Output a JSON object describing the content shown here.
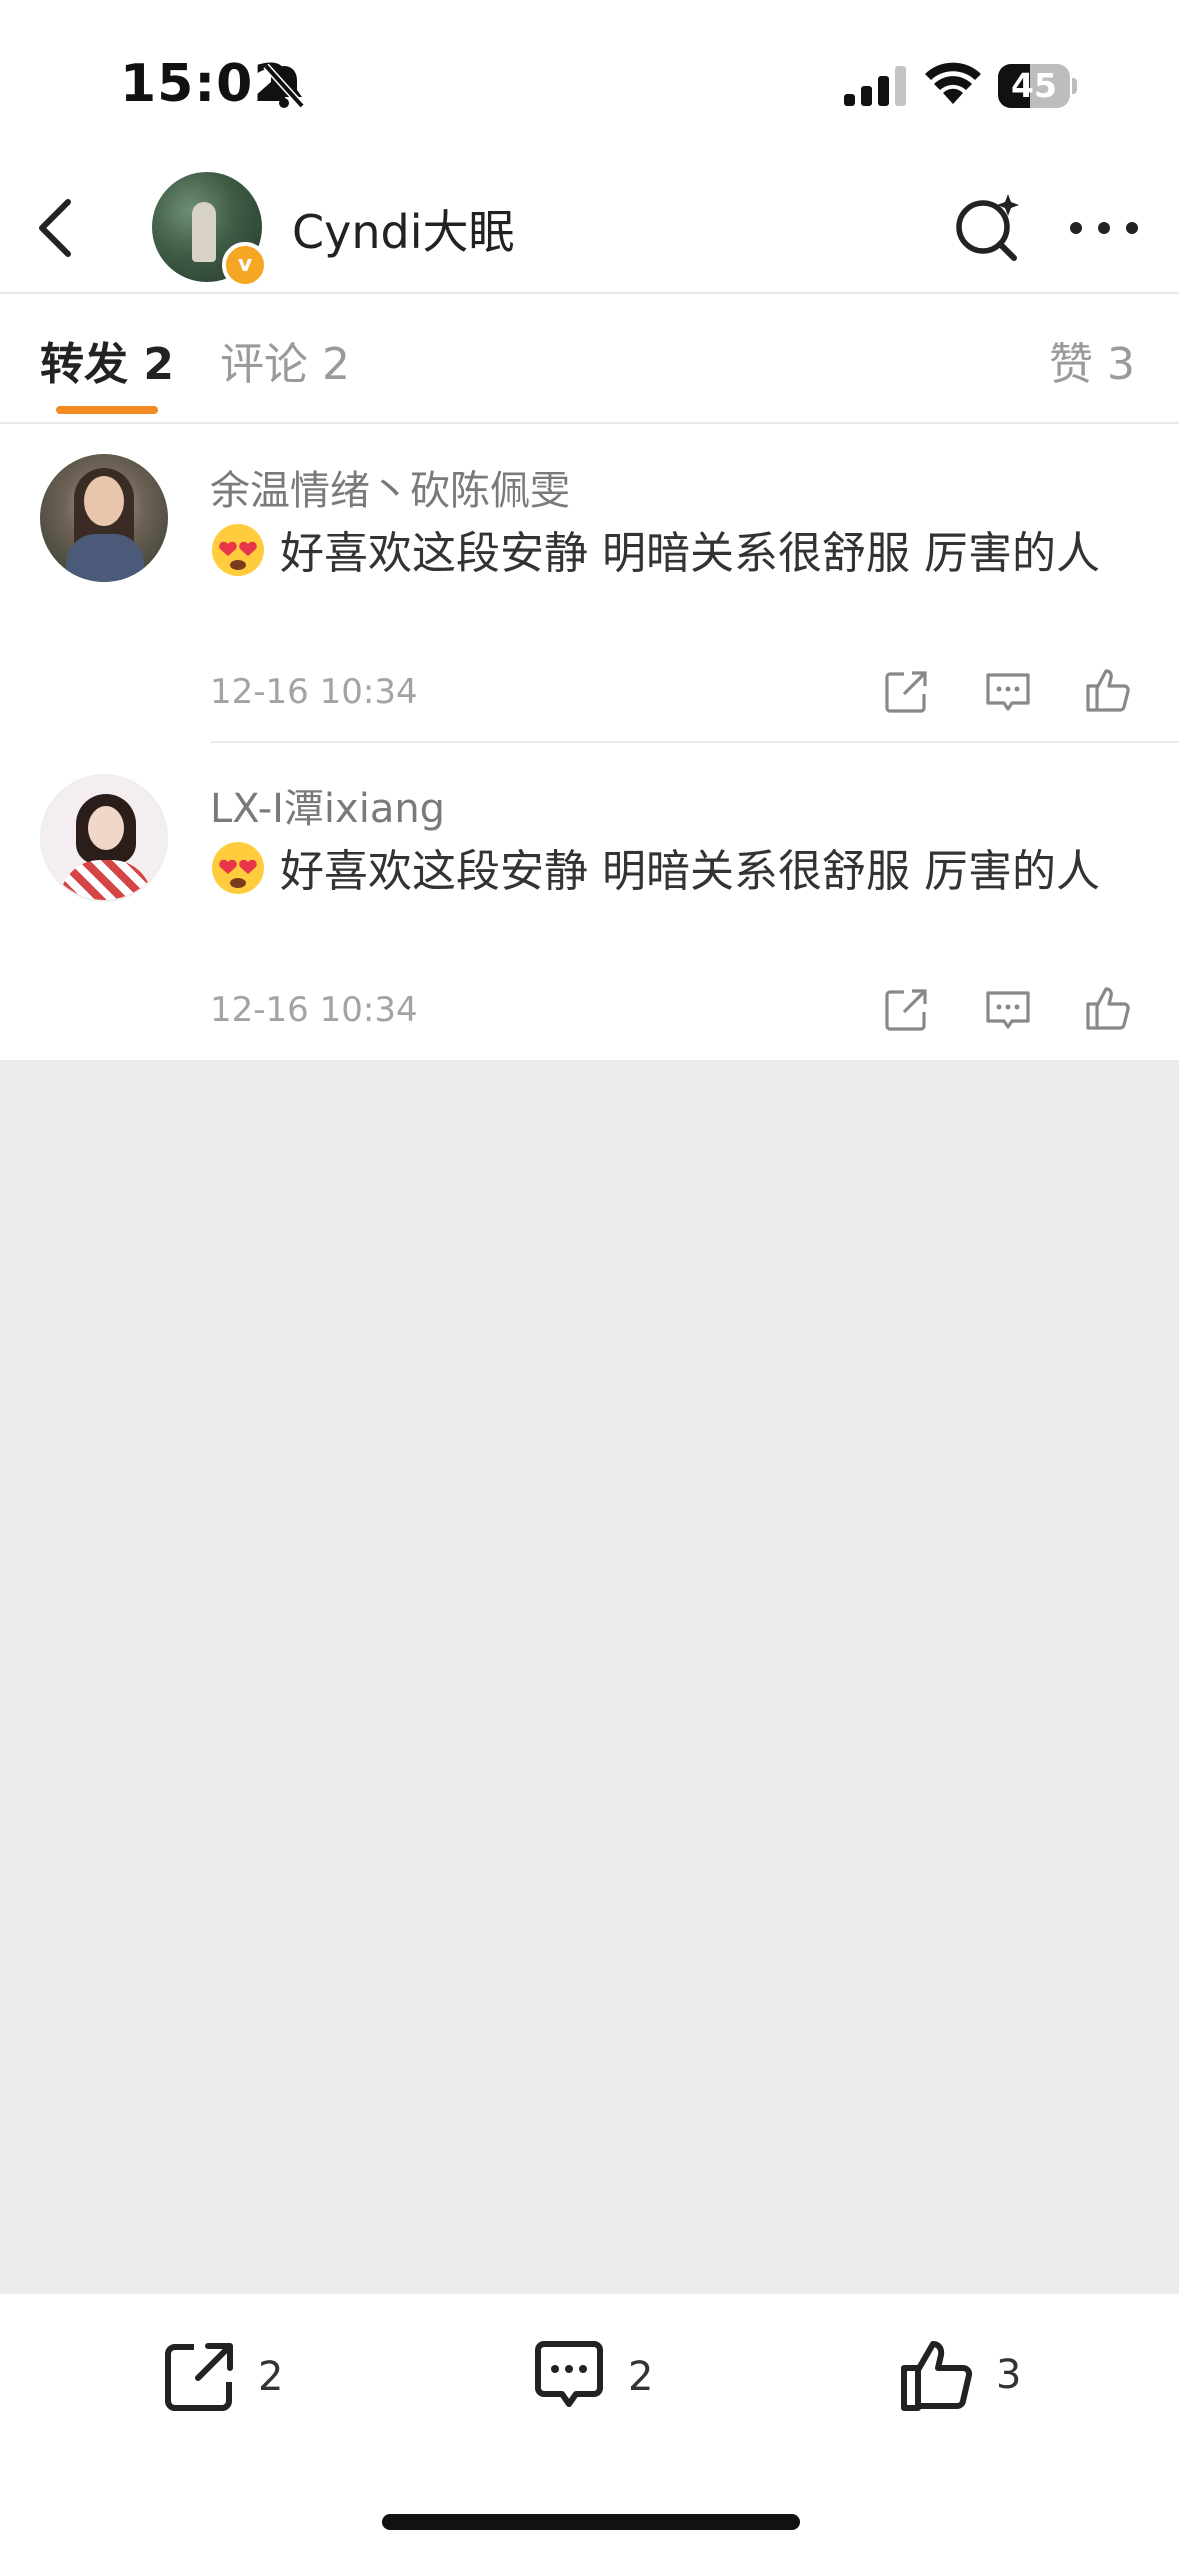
{
  "status_bar": {
    "time": "15:02",
    "mute_icon": "bell-slash-icon",
    "signal_icon": "cellular-signal-icon",
    "wifi_icon": "wifi-icon",
    "battery": "45",
    "battery_level": 0.45
  },
  "header": {
    "back_icon": "chevron-left-icon",
    "name": "Cyndi大眠",
    "verified_badge": "v",
    "search_icon": "search-sparkle-icon",
    "more_icon": "more-dots-icon"
  },
  "tabs": {
    "repost": "转发 2",
    "comment": "评论 2",
    "like": "赞 3",
    "active_color": "#f08a24"
  },
  "reposts": [
    {
      "username": "余温情绪丶砍陈佩雯",
      "emoji": "heart-eyes-emoji",
      "text": "好喜欢这段安静 明暗关系很舒服 厉害的人",
      "time": "12-16 10:34"
    },
    {
      "username": "LX-I潭ixiang",
      "emoji": "heart-eyes-emoji",
      "text": "好喜欢这段安静 明暗关系很舒服 厉害的人",
      "time": "12-16 10:34"
    }
  ],
  "row_actions": [
    "share-icon",
    "comment-icon",
    "like-icon"
  ],
  "bottom_bar": {
    "repost_count": "2",
    "comment_count": "2",
    "like_count": "3"
  }
}
